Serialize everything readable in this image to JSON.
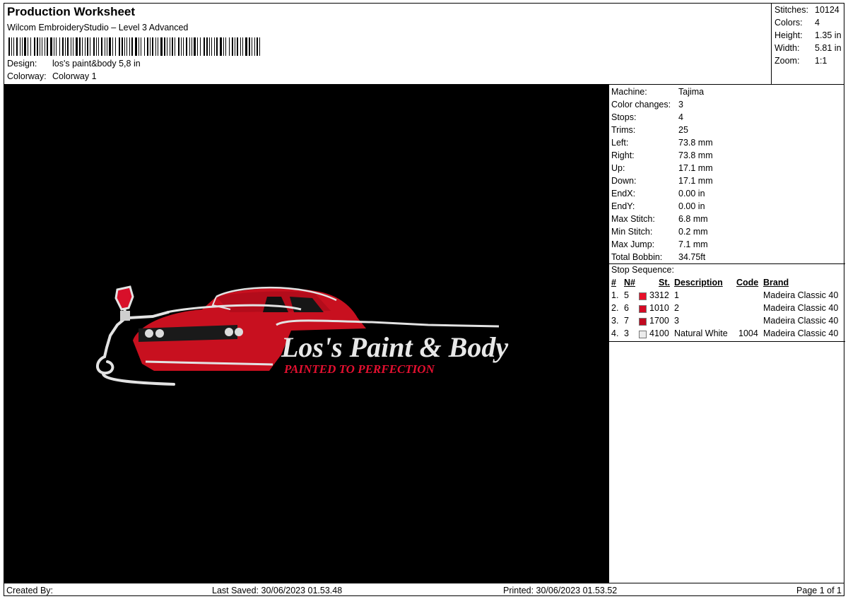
{
  "header": {
    "title": "Production Worksheet",
    "subtitle": "Wilcom EmbroideryStudio – Level 3 Advanced",
    "design_label": "Design:",
    "design_value": "los's paint&body 5,8 in",
    "colorway_label": "Colorway:",
    "colorway_value": "Colorway 1"
  },
  "stats": [
    {
      "label": "Stitches:",
      "value": "10124"
    },
    {
      "label": "Colors:",
      "value": "4"
    },
    {
      "label": "Height:",
      "value": "1.35 in"
    },
    {
      "label": "Width:",
      "value": "5.81 in"
    },
    {
      "label": "Zoom:",
      "value": "1:1"
    }
  ],
  "machine": [
    {
      "label": "Machine:",
      "value": "Tajima"
    },
    {
      "label": "Color changes:",
      "value": "3"
    },
    {
      "label": "Stops:",
      "value": "4"
    },
    {
      "label": "Trims:",
      "value": "25"
    },
    {
      "label": "Left:",
      "value": "73.8 mm"
    },
    {
      "label": "Right:",
      "value": "73.8 mm"
    },
    {
      "label": "Up:",
      "value": "17.1 mm"
    },
    {
      "label": "Down:",
      "value": "17.1 mm"
    },
    {
      "label": "EndX:",
      "value": "0.00 in"
    },
    {
      "label": "EndY:",
      "value": "0.00 in"
    },
    {
      "label": "Max Stitch:",
      "value": "6.8 mm"
    },
    {
      "label": "Min Stitch:",
      "value": "0.2 mm"
    },
    {
      "label": "Max Jump:",
      "value": "7.1 mm"
    },
    {
      "label": "Total Bobbin:",
      "value": "34.75ft"
    }
  ],
  "stop_sequence": {
    "title": "Stop Sequence:",
    "columns": {
      "num": "#",
      "n": "N#",
      "st": "St.",
      "description": "Description",
      "code": "Code",
      "brand": "Brand"
    },
    "rows": [
      {
        "num": "1.",
        "n": "5",
        "color": "#e8102a",
        "st": "3312",
        "description": "1",
        "code": "",
        "brand": "Madeira Classic 40"
      },
      {
        "num": "2.",
        "n": "6",
        "color": "#d40a24",
        "st": "1010",
        "description": "2",
        "code": "",
        "brand": "Madeira Classic 40"
      },
      {
        "num": "3.",
        "n": "7",
        "color": "#c10a20",
        "st": "1700",
        "description": "3",
        "code": "",
        "brand": "Madeira Classic 40"
      },
      {
        "num": "4.",
        "n": "3",
        "color": "#ececec",
        "st": "4100",
        "description": "Natural White",
        "code": "1004",
        "brand": "Madeira Classic 40"
      }
    ]
  },
  "design": {
    "logo_title": "Los's Paint & Body",
    "logo_tagline": "PAINTED TO PERFECTION",
    "red": "#d8102a",
    "white": "#e8e8e8"
  },
  "footer": {
    "created_by": "Created By:",
    "last_saved": "Last Saved: 30/06/2023 01.53.48",
    "printed": "Printed: 30/06/2023 01.53.52",
    "page": "Page 1 of 1"
  }
}
